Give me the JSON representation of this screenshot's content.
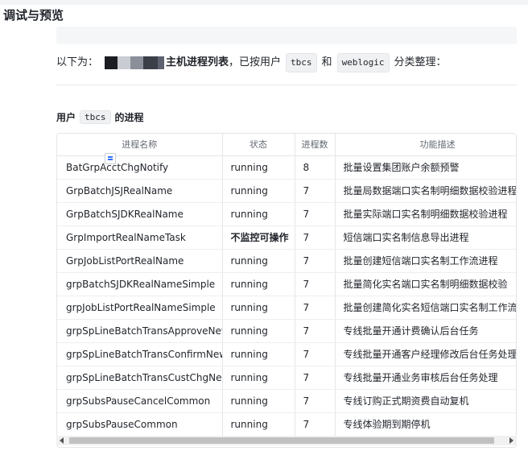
{
  "page": {
    "title": "调试与预览"
  },
  "intro": {
    "prefix": "以下为：",
    "bold_text": "主机进程列表",
    "middle": "，已按用户",
    "user1": "tbcs",
    "and": "和",
    "user2": "weblogic",
    "suffix": "分类整理："
  },
  "section": {
    "prefix": "用户",
    "user": "tbcs",
    "suffix": "的进程"
  },
  "table": {
    "headers": [
      "进程名称",
      "状态",
      "进程数",
      "功能描述"
    ],
    "rows": [
      {
        "name": "BatGrpAcctChgNotify",
        "status": "running",
        "count": "8",
        "desc": "批量设置集团账户余额预警"
      },
      {
        "name": "GrpBatchJSJRealName",
        "status": "running",
        "count": "7",
        "desc": "批量局数据端口实名制明细数据校验进程"
      },
      {
        "name": "GrpBatchSJDKRealName",
        "status": "running",
        "count": "7",
        "desc": "批量实际端口实名制明细数据校验进程"
      },
      {
        "name": "GrpImportRealNameTask",
        "status": "不监控可操作",
        "count": "7",
        "desc": "短信端口实名制信息导出进程"
      },
      {
        "name": "GrpJobListPortRealName",
        "status": "running",
        "count": "7",
        "desc": "批量创建短信端口实名制工作流进程"
      },
      {
        "name": "grpBatchSJDKRealNameSimple",
        "status": "running",
        "count": "7",
        "desc": "批量简化实名端口实名制明细数据校验"
      },
      {
        "name": "grpJobListPortRealNameSimple",
        "status": "running",
        "count": "7",
        "desc": "批量创建简化实名短信端口实名制工作流"
      },
      {
        "name": "grpSpLineBatchTransApproveNew",
        "status": "running",
        "count": "7",
        "desc": "专线批量开通计费确认后台任务"
      },
      {
        "name": "grpSpLineBatchTransConfirmNew",
        "status": "running",
        "count": "7",
        "desc": "专线批量开通客户经理修改后台任务处理"
      },
      {
        "name": "grpSpLineBatchTransCustChgNew",
        "status": "running",
        "count": "7",
        "desc": "专线批量开通业务审核后台任务处理"
      },
      {
        "name": "grpSubsPauseCancelCommon",
        "status": "running",
        "count": "7",
        "desc": "专线订购正式期资费自动复机"
      },
      {
        "name": "grpSubsPauseCommon",
        "status": "running",
        "count": "7",
        "desc": "专线体验期到期停机"
      }
    ]
  }
}
